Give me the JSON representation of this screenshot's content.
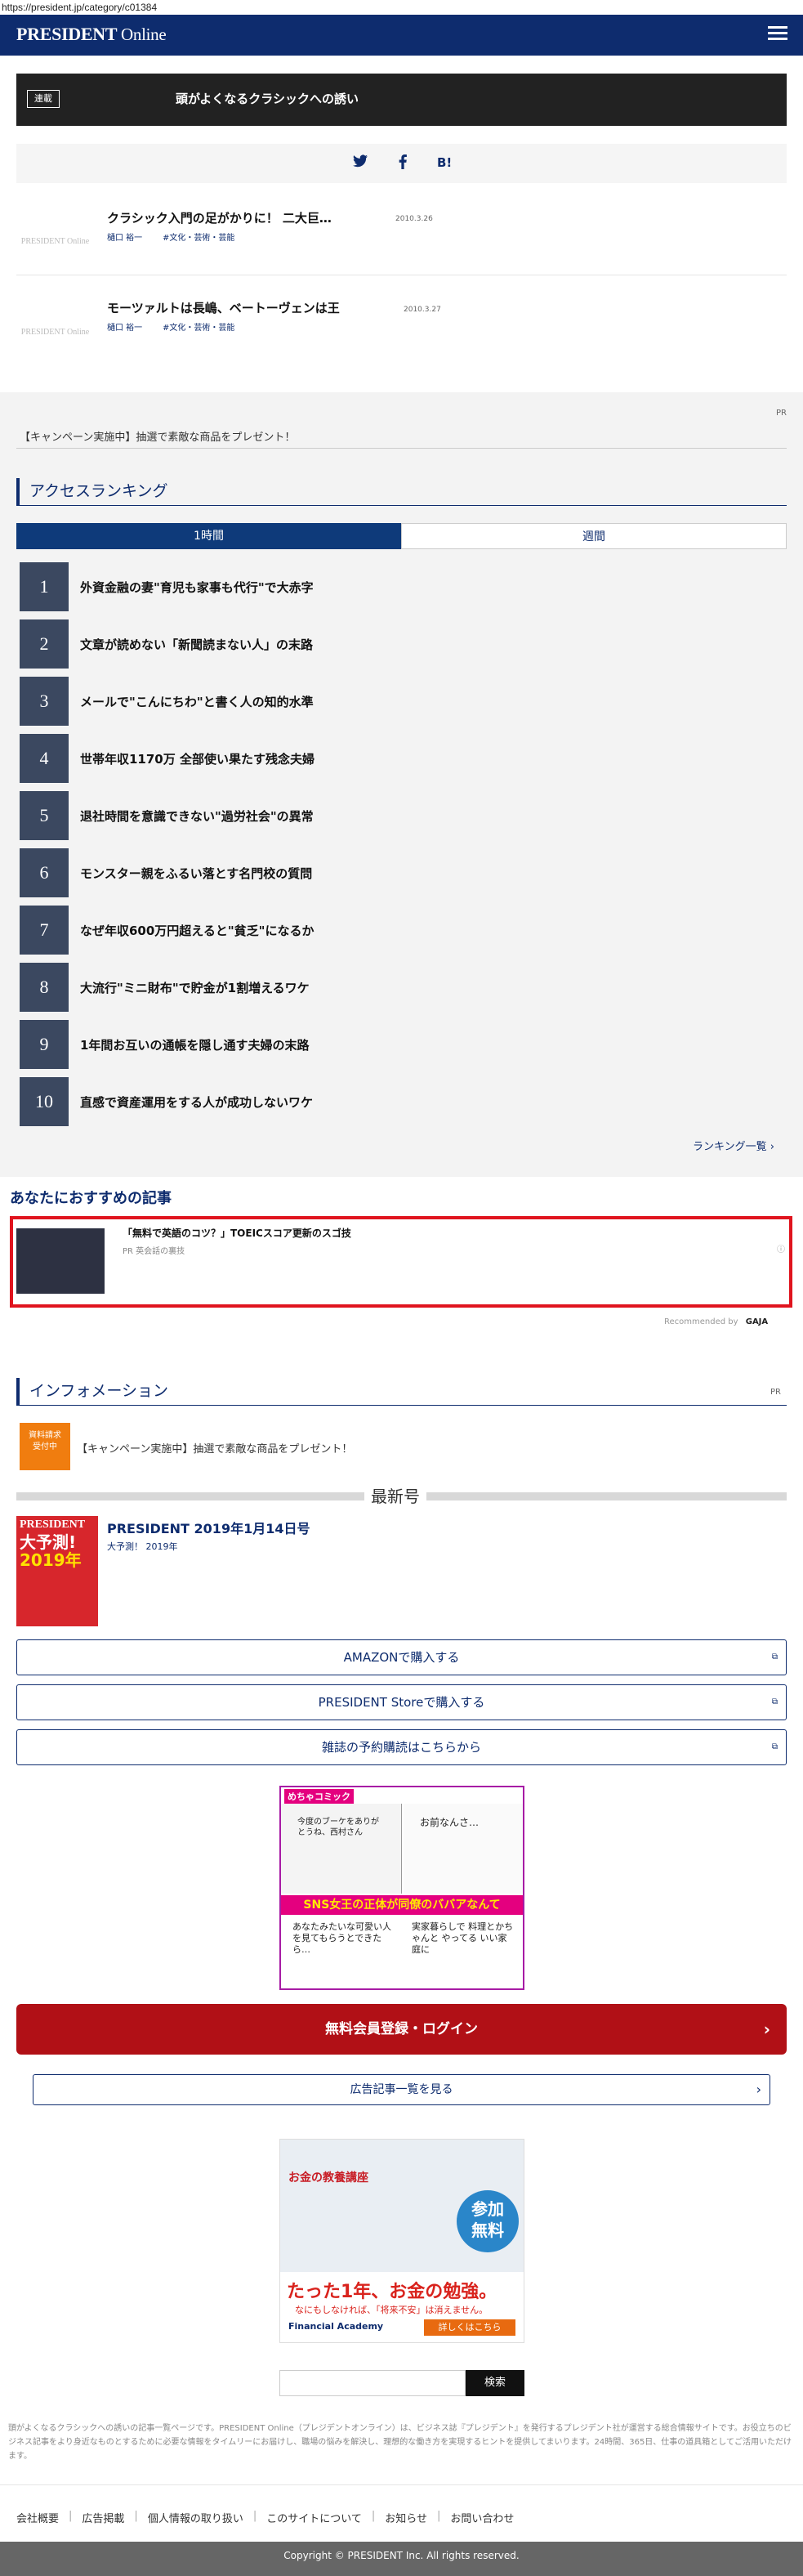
{
  "browser": {
    "url": "https://president.jp/category/c01384"
  },
  "header": {
    "logo_main": "PRESIDENT",
    "logo_sub": "Online",
    "menu_icon": "hamburger-icon"
  },
  "series": {
    "tag": "連載",
    "title": "頭がよくなるクラシックへの誘い"
  },
  "share": {
    "twitter_icon": "twitter-icon",
    "facebook_icon": "facebook-icon",
    "hatena_label": "B!"
  },
  "articles": [
    {
      "thumb_text": "PRESIDENT Online",
      "title": "クラシック入門の足がかりに！ 二大巨…",
      "author": "樋口 裕一",
      "category": "#文化・芸術・芸能",
      "date": "2010.3.26"
    },
    {
      "thumb_text": "PRESIDENT Online",
      "title": "モーツァルトは長嶋、ベートーヴェンは王",
      "author": "樋口 裕一",
      "category": "#文化・芸術・芸能",
      "date": "2010.3.27"
    }
  ],
  "pr_top": {
    "pr": "PR",
    "text": "【キャンペーン実施中】抽選で素敵な商品をプレゼント！"
  },
  "ranking": {
    "heading": "アクセスランキング",
    "tabs": [
      {
        "label": "1時間",
        "active": true
      },
      {
        "label": "週間",
        "active": false
      }
    ],
    "items": [
      {
        "rank": "1",
        "title": "外資金融の妻\"育児も家事も代行\"で大赤字"
      },
      {
        "rank": "2",
        "title": "文章が読めない「新聞読まない人」の末路"
      },
      {
        "rank": "3",
        "title": "メールで\"こんにちわ\"と書く人の知的水準"
      },
      {
        "rank": "4",
        "title": "世帯年収1170万 全部使い果たす残念夫婦"
      },
      {
        "rank": "5",
        "title": "退社時間を意識できない\"過労社会\"の異常"
      },
      {
        "rank": "6",
        "title": "モンスター親をふるい落とす名門校の質問"
      },
      {
        "rank": "7",
        "title": "なぜ年収600万円超えると\"貧乏\"になるか"
      },
      {
        "rank": "8",
        "title": "大流行\"ミニ財布\"で貯金が1割増えるワケ"
      },
      {
        "rank": "9",
        "title": "1年間お互いの通帳を隠し通す夫婦の末路"
      },
      {
        "rank": "10",
        "title": "直感で資産運用をする人が成功しないワケ"
      }
    ],
    "more_link": "ランキング一覧"
  },
  "recommended": {
    "heading": "あなたにおすすめの記事",
    "item_title": "「無料で英語のコツ？」TOEICスコア更新のスゴ技",
    "item_sub": "PR 英会話の裏技",
    "recommended_by": "Recommended by",
    "brand": "GAJA"
  },
  "information": {
    "heading": "インフォメーション",
    "pr": "PR",
    "badge_line1": "資料請求",
    "badge_line2": "受付中",
    "text": "【キャンペーン実施中】抽選で素敵な商品をプレゼント！"
  },
  "latest_issue": {
    "label": "最新号",
    "cover_brand": "PRESIDENT",
    "cover_headline1": "大予測!",
    "cover_headline2": "2019年",
    "title": "PRESIDENT 2019年1月14日号",
    "subtitle": "大予測！ 2019年",
    "buttons": [
      "AMAZONで購入する",
      "PRESIDENT Storeで購入する",
      "雑誌の予約購読はこちらから"
    ]
  },
  "ad_comic": {
    "brand": "めちゃコミック",
    "bubble1": "今度のブーケをありがとうね、西村さん",
    "bubble2": "お前なんさ…",
    "band": "SNS女王の正体が同僚のババアなんて",
    "bubble3": "あなたみたいな可愛い人を見てもらうとできたら…",
    "bubble4": "実家暮らしで 料理とかちゃんと やってる いい家庭に"
  },
  "login_button": "無料会員登録・ログイン",
  "ad_list_button": "広告記事一覧を見る",
  "ad_money": {
    "header": "お金の教養講座",
    "badge_line1": "参加",
    "badge_line2": "無料",
    "headline": "たった1年、お金の勉強。",
    "subline": "なにもしなければ、「将来不安」は消えません。",
    "brand": "Financial Academy",
    "cta": "詳しくはこちら"
  },
  "search": {
    "placeholder": "",
    "button": "検索"
  },
  "footer": {
    "description": "頭がよくなるクラシックへの誘いの記事一覧ページです。PRESIDENT Online（プレジデントオンライン）は、ビジネス誌『プレジデント』を発行するプレジデント社が運営する総合情報サイトです。お役立ちのビジネス記事をより身近なものとするために必要な情報をタイムリーにお届けし、職場の悩みを解決し、理想的な働き方を実現するヒントを提供してまいります。24時間、365日、仕事の道具箱としてご活用いただけます。",
    "links": [
      "会社概要",
      "広告掲載",
      "個人情報の取り扱い",
      "このサイトについて",
      "お知らせ",
      "お問い合わせ"
    ],
    "copyright": "Copyright © PRESIDENT Inc. All rights reserved."
  }
}
